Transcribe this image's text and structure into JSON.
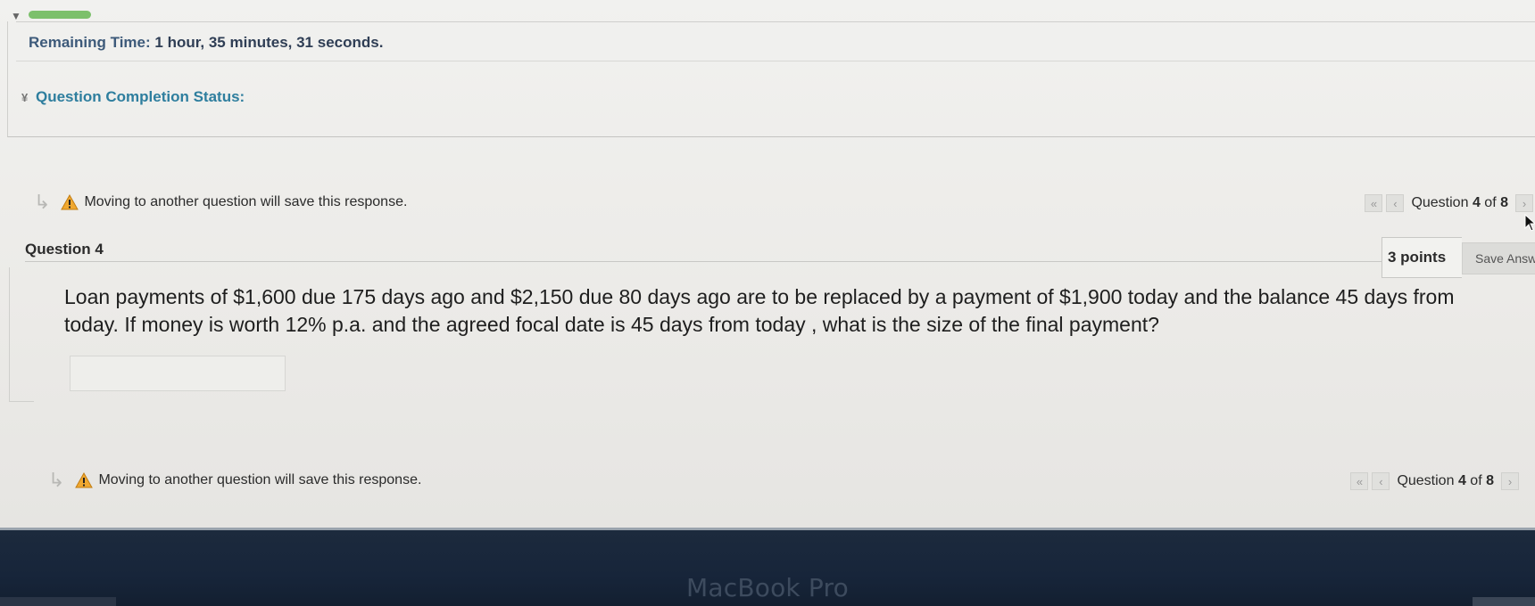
{
  "header": {
    "remaining_label": "Remaining Time:",
    "remaining_value": "1 hour, 35 minutes, 31 seconds.",
    "completion_label": "Question Completion Status:"
  },
  "notice": {
    "text": "Moving to another question will save this response."
  },
  "pager": {
    "first_icon": "double-chevron-left-icon",
    "prev_icon": "chevron-left-icon",
    "next_icon": "chevron-right-icon",
    "label_prefix": "Question",
    "current": "4",
    "of_word": "of",
    "total": "8"
  },
  "question": {
    "title": "Question 4",
    "points": "3 points",
    "save_label": "Save Answ",
    "text": "Loan payments of $1,600 due 175 days ago and $2,150 due 80 days ago are to be replaced by a payment of $1,900 today and the balance 45 days from today. If money is worth 12% p.a. and the agreed focal date is 45 days from today , what is the size of the final payment?",
    "answer_value": ""
  },
  "device": {
    "brand": "MacBook Pro"
  },
  "colors": {
    "progress": "#7cc06b",
    "completion_link": "#2e7e9e",
    "warning": "#f0a830"
  }
}
